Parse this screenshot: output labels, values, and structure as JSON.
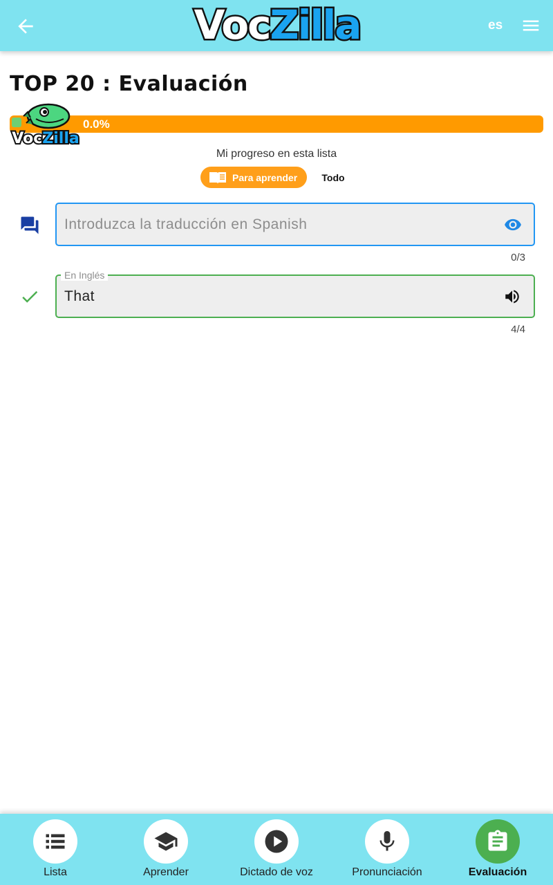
{
  "header": {
    "logo_voc": "Voc",
    "logo_zilla": "Zilla",
    "language": "es"
  },
  "page": {
    "title": "TOP 20 : Evaluación"
  },
  "progress": {
    "value_percent": 0.0,
    "text": "0.0%",
    "mascot_logo": "VocZilla",
    "label": "Mi progreso en esta lista"
  },
  "filters": {
    "learn_label": "Para aprender",
    "all_label": "Todo"
  },
  "answer_field": {
    "placeholder": "Introduzca la traducción en Spanish",
    "value": "",
    "counter": "0/3"
  },
  "source_field": {
    "label": "En Inglés",
    "word": "That",
    "counter": "4/4"
  },
  "bottom_nav": {
    "items": [
      {
        "label": "Lista",
        "icon": "list-icon"
      },
      {
        "label": "Aprender",
        "icon": "graduation-cap-icon"
      },
      {
        "label": "Dictado de voz",
        "icon": "play-icon"
      },
      {
        "label": "Pronunciación",
        "icon": "microphone-icon"
      },
      {
        "label": "Evaluación",
        "icon": "clipboard-icon"
      }
    ],
    "active_index": 4
  },
  "colors": {
    "header_bg": "#7fe3f0",
    "progress_bar": "#ff9a00",
    "answer_border": "#2196f3",
    "source_border": "#4caf50",
    "active_nav": "#4caf50"
  }
}
